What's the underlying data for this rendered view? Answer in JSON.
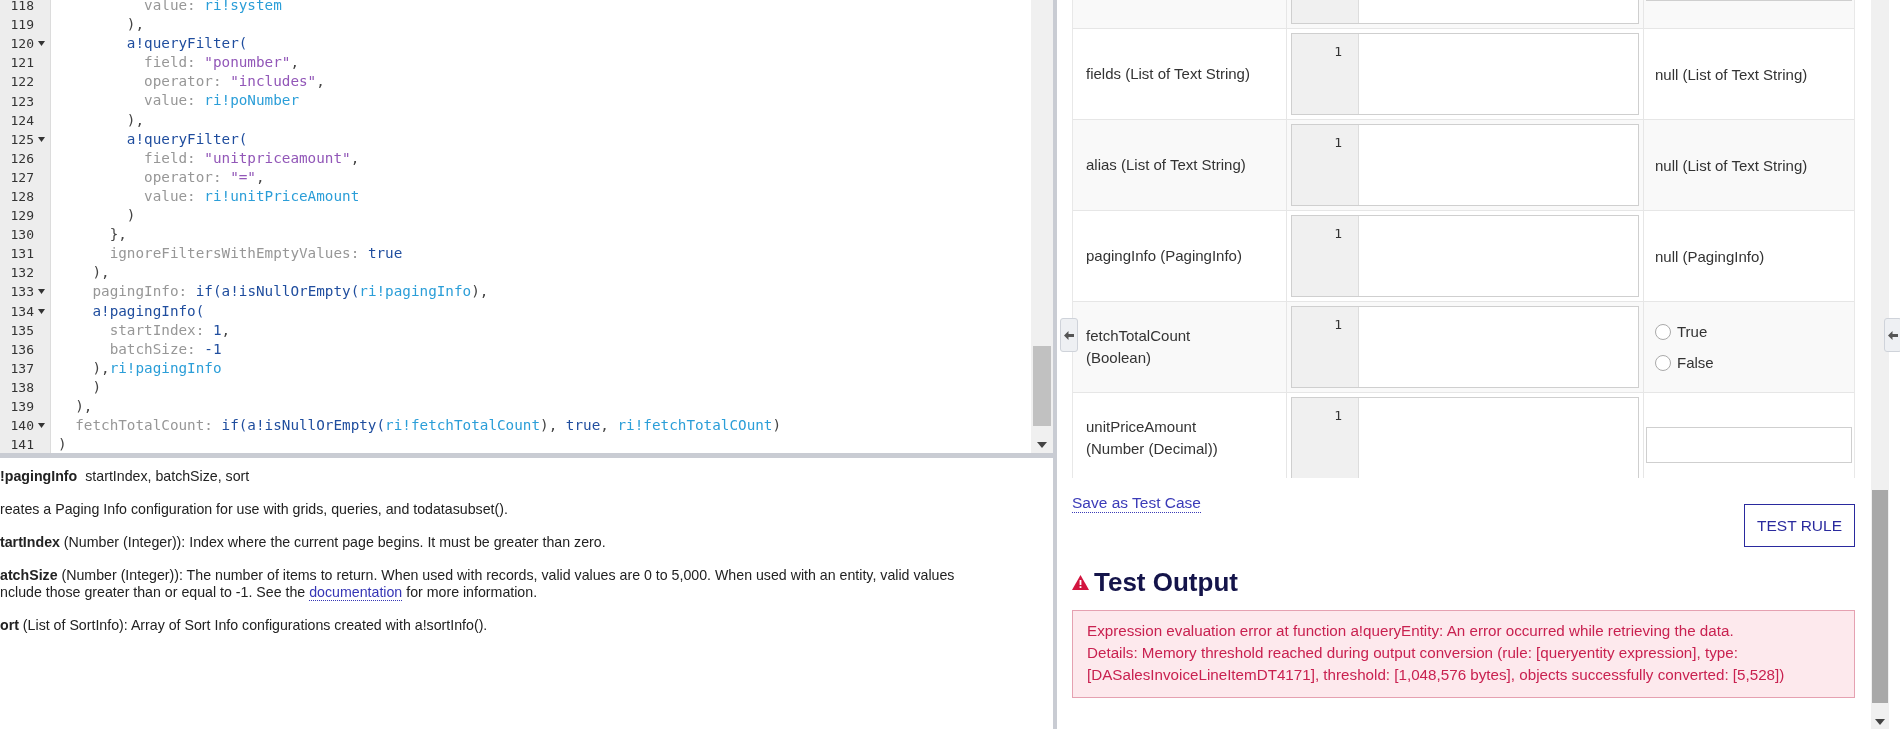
{
  "editor": {
    "lines": [
      {
        "number": "118",
        "fold": false,
        "tokens": [
          {
            "kind": "key",
            "text": "          value: "
          },
          {
            "kind": "ri",
            "text": "ri!system"
          }
        ]
      },
      {
        "number": "119",
        "fold": false,
        "tokens": [
          {
            "kind": "punc",
            "text": "        ),"
          }
        ]
      },
      {
        "number": "120",
        "fold": true,
        "tokens": [
          {
            "kind": "fn",
            "text": "        a!queryFilter("
          }
        ]
      },
      {
        "number": "121",
        "fold": false,
        "tokens": [
          {
            "kind": "key",
            "text": "          field: "
          },
          {
            "kind": "str",
            "text": "\"ponumber\""
          },
          {
            "kind": "punc",
            "text": ","
          }
        ]
      },
      {
        "number": "122",
        "fold": false,
        "tokens": [
          {
            "kind": "key",
            "text": "          operator: "
          },
          {
            "kind": "str",
            "text": "\"includes\""
          },
          {
            "kind": "punc",
            "text": ","
          }
        ]
      },
      {
        "number": "123",
        "fold": false,
        "tokens": [
          {
            "kind": "key",
            "text": "          value: "
          },
          {
            "kind": "ri",
            "text": "ri!poNumber"
          }
        ]
      },
      {
        "number": "124",
        "fold": false,
        "tokens": [
          {
            "kind": "punc",
            "text": "        ),"
          }
        ]
      },
      {
        "number": "125",
        "fold": true,
        "tokens": [
          {
            "kind": "fn",
            "text": "        a!queryFilter("
          }
        ]
      },
      {
        "number": "126",
        "fold": false,
        "tokens": [
          {
            "kind": "key",
            "text": "          field: "
          },
          {
            "kind": "str",
            "text": "\"unitpriceamount\""
          },
          {
            "kind": "punc",
            "text": ","
          }
        ]
      },
      {
        "number": "127",
        "fold": false,
        "tokens": [
          {
            "kind": "key",
            "text": "          operator: "
          },
          {
            "kind": "str",
            "text": "\"=\""
          },
          {
            "kind": "punc",
            "text": ","
          }
        ]
      },
      {
        "number": "128",
        "fold": false,
        "tokens": [
          {
            "kind": "key",
            "text": "          value: "
          },
          {
            "kind": "ri",
            "text": "ri!unitPriceAmount"
          }
        ]
      },
      {
        "number": "129",
        "fold": false,
        "tokens": [
          {
            "kind": "punc",
            "text": "        )"
          }
        ]
      },
      {
        "number": "130",
        "fold": false,
        "tokens": [
          {
            "kind": "punc",
            "text": "      },"
          }
        ]
      },
      {
        "number": "131",
        "fold": false,
        "tokens": [
          {
            "kind": "key",
            "text": "      ignoreFiltersWithEmptyValues: "
          },
          {
            "kind": "lit",
            "text": "true"
          }
        ]
      },
      {
        "number": "132",
        "fold": false,
        "tokens": [
          {
            "kind": "punc",
            "text": "    ),"
          }
        ]
      },
      {
        "number": "133",
        "fold": true,
        "tokens": [
          {
            "kind": "key",
            "text": "    pagingInfo: "
          },
          {
            "kind": "fn",
            "text": "if(a!isNullOrEmpty("
          },
          {
            "kind": "ri",
            "text": "ri!pagingInfo"
          },
          {
            "kind": "punc",
            "text": "),"
          }
        ]
      },
      {
        "number": "134",
        "fold": true,
        "tokens": [
          {
            "kind": "fn",
            "text": "    a!pagingInfo("
          }
        ]
      },
      {
        "number": "135",
        "fold": false,
        "tokens": [
          {
            "kind": "key",
            "text": "      startIndex: "
          },
          {
            "kind": "lit",
            "text": "1"
          },
          {
            "kind": "punc",
            "text": ","
          }
        ]
      },
      {
        "number": "136",
        "fold": false,
        "tokens": [
          {
            "kind": "key",
            "text": "      batchSize: "
          },
          {
            "kind": "lit",
            "text": "-1"
          }
        ]
      },
      {
        "number": "137",
        "fold": false,
        "tokens": [
          {
            "kind": "punc",
            "text": "    ),"
          },
          {
            "kind": "ri",
            "text": "ri!pagingInfo"
          }
        ]
      },
      {
        "number": "138",
        "fold": false,
        "tokens": [
          {
            "kind": "punc",
            "text": "    )"
          }
        ]
      },
      {
        "number": "139",
        "fold": false,
        "tokens": [
          {
            "kind": "punc",
            "text": "  ),"
          }
        ]
      },
      {
        "number": "140",
        "fold": true,
        "tokens": [
          {
            "kind": "key",
            "text": "  fetchTotalCount: "
          },
          {
            "kind": "fn",
            "text": "if(a!isNullOrEmpty("
          },
          {
            "kind": "ri",
            "text": "ri!fetchTotalCount"
          },
          {
            "kind": "punc",
            "text": "), "
          },
          {
            "kind": "lit",
            "text": "true"
          },
          {
            "kind": "punc",
            "text": ", "
          },
          {
            "kind": "ri",
            "text": "ri!fetchTotalCOunt"
          },
          {
            "kind": "punc",
            "text": ")"
          }
        ]
      },
      {
        "number": "141",
        "fold": false,
        "tokens": [
          {
            "kind": "punc",
            "text": ")"
          }
        ]
      }
    ]
  },
  "doc": {
    "name": "!pagingInfo",
    "signature": "startIndex, batchSize, sort",
    "description": "reates a Paging Info configuration for use with grids, queries, and todatasubset().",
    "params": [
      {
        "lines": [
          {
            "text": "**tartIndex** (Number (Integer)): Index where the current page begins. It must be greater than zero."
          }
        ]
      },
      {
        "lines": [
          {
            "text": "**atchSize** (Number (Integer)): The number of items to return. When used with records, valid values are 0 to 5,000. When used with an entity, valid values"
          },
          {
            "text": "nclude those greater than or equal to -1. See the ",
            "link": "documentation",
            "after": " for more information."
          }
        ]
      },
      {
        "lines": [
          {
            "text": "**ort** (List of SortInfo): Array of Sort Info configurations created with a!sortInfo()."
          }
        ]
      }
    ]
  },
  "test_inputs": {
    "rows": [
      {
        "label": [],
        "number": "",
        "value": {
          "kind": "input"
        }
      },
      {
        "label": [
          "fields (List of Text String)"
        ],
        "number": "1",
        "value": {
          "kind": "text",
          "text": "null (List of Text String)"
        }
      },
      {
        "label": [
          "alias (List of Text String)"
        ],
        "number": "1",
        "value": {
          "kind": "text",
          "text": "null (List of Text String)"
        }
      },
      {
        "label": [
          "pagingInfo (PagingInfo)"
        ],
        "number": "1",
        "value": {
          "kind": "text",
          "text": "null (PagingInfo)"
        }
      },
      {
        "label": [
          "fetchTotalCount",
          "(Boolean)"
        ],
        "number": "1",
        "value": {
          "kind": "radio",
          "options": [
            {
              "label": "True",
              "selected": false
            },
            {
              "label": "False",
              "selected": false
            }
          ]
        }
      },
      {
        "label": [
          "unitPriceAmount",
          "(Number (Decimal))"
        ],
        "number": "1",
        "value": {
          "kind": "input"
        }
      }
    ]
  },
  "actions": {
    "save_link": "Save as Test Case",
    "test_button": "TEST RULE"
  },
  "test_output": {
    "heading": "Test Output",
    "error": [
      "Expression evaluation error at function a!queryEntity: An error occurred while retrieving the data.",
      "Details: Memory threshold reached during output conversion (rule: [queryentity expression], type: [DASalesInvoiceLineItemDT4171], threshold: [1,048,576 bytes], objects successfully converted: [5,528])"
    ]
  }
}
